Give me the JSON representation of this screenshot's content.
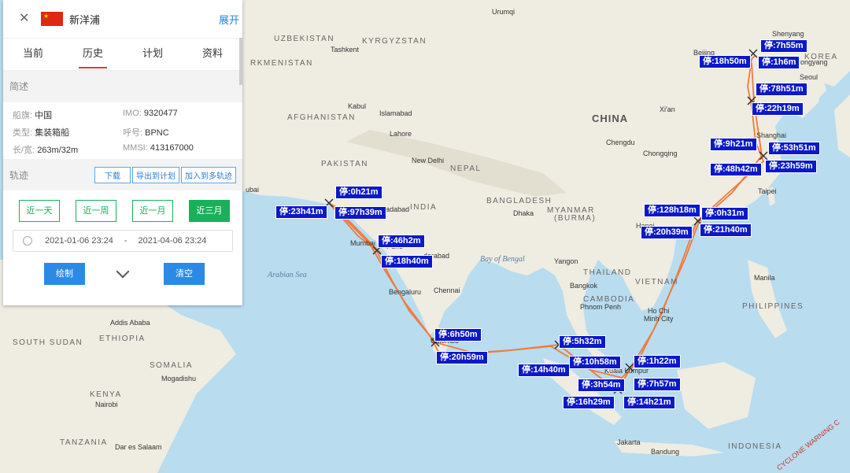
{
  "panel": {
    "ship_name": "新洋浦",
    "expand_label": "展开",
    "tabs": [
      "当前",
      "历史",
      "计划",
      "资料"
    ],
    "active_tab": 1,
    "summary_title": "简述",
    "info": [
      {
        "k": "船旗:",
        "v": "中国"
      },
      {
        "k": "IMO:",
        "v": "9320477"
      },
      {
        "k": "类型:",
        "v": "集装箱船"
      },
      {
        "k": "呼号:",
        "v": "BPNC"
      },
      {
        "k": "长/宽:",
        "v": "263m/32m"
      },
      {
        "k": "MMSI:",
        "v": "413167000"
      }
    ],
    "track_title": "轨迹",
    "track_buttons": [
      "下载",
      "导出到计划",
      "加入到多轨迹"
    ],
    "ranges": [
      "近一天",
      "近一周",
      "近一月",
      "近三月"
    ],
    "active_range": 3,
    "date_start": "2021-01-06 23:24",
    "date_sep": "-",
    "date_end": "2021-04-06 23:24",
    "draw_label": "绘制",
    "clear_label": "清空"
  },
  "map": {
    "places": [
      "Urumqi",
      "UZBEKISTAN",
      "KYRGYZSTAN",
      "Tashkent",
      "RKMENISTAN",
      "Kabul",
      "AFGHANISTAN",
      "Islamabad",
      "Lahore",
      "PAKISTAN",
      "New Delhi",
      "NEPAL",
      "CHINA",
      "Chengdu",
      "Chongqing",
      "Xi'an",
      "Beijing",
      "Shenyang",
      "Seoul",
      "KOREA",
      "ongyang",
      "Shanghai",
      "Taipei",
      "INDIA",
      "adabad",
      "Mumbai",
      "Pune",
      "derabad",
      "Bengaluru",
      "Chennai",
      "Bay of Bengal",
      "Arabian Sea",
      "BANGLADESH",
      "Dhaka",
      "MYANMAR",
      "(BURMA)",
      "Yangon",
      "THAILAND",
      "Bangkok",
      "Phnom Penh",
      "CAMBODIA",
      "VIETNAM",
      "Hanoi",
      "Ho Chi",
      "Minh City",
      "Manila",
      "PHILIPPINES",
      "Kuala Lumpur",
      "INDONESIA",
      "Jakarta",
      "Bandung",
      "Colombo",
      "Addis Ababa",
      "ETHIOPIA",
      "SOUTH SUDAN",
      "SOMALIA",
      "Mogadishu",
      "KENYA",
      "Nairobi",
      "TANZANIA",
      "Dar es Salaam",
      "ubai",
      "CYCLONE WARNING C"
    ],
    "stops": [
      "停:7h55m",
      "停:18h50m",
      "停:1h6m",
      "停:78h51m",
      "停:22h19m",
      "停:9h21m",
      "停:53h51m",
      "停:48h42m",
      "停:23h59m",
      "停:128h18m",
      "停:0h31m",
      "停:20h39m",
      "停:21h40m",
      "停:0h21m",
      "停:23h41m",
      "停:97h39m",
      "停:46h2m",
      "停:18h40m",
      "停:6h50m",
      "停:20h59m",
      "停:5h32m",
      "停:10h58m",
      "停:14h40m",
      "停:1h22m",
      "停:3h54m",
      "停:7h57m",
      "停:16h29m",
      "停:14h21m"
    ],
    "colors": {
      "sea": "#b9dcef",
      "land": "#f1eee4",
      "route": "#f07a3c",
      "stop_label": "#0b19c9"
    }
  }
}
